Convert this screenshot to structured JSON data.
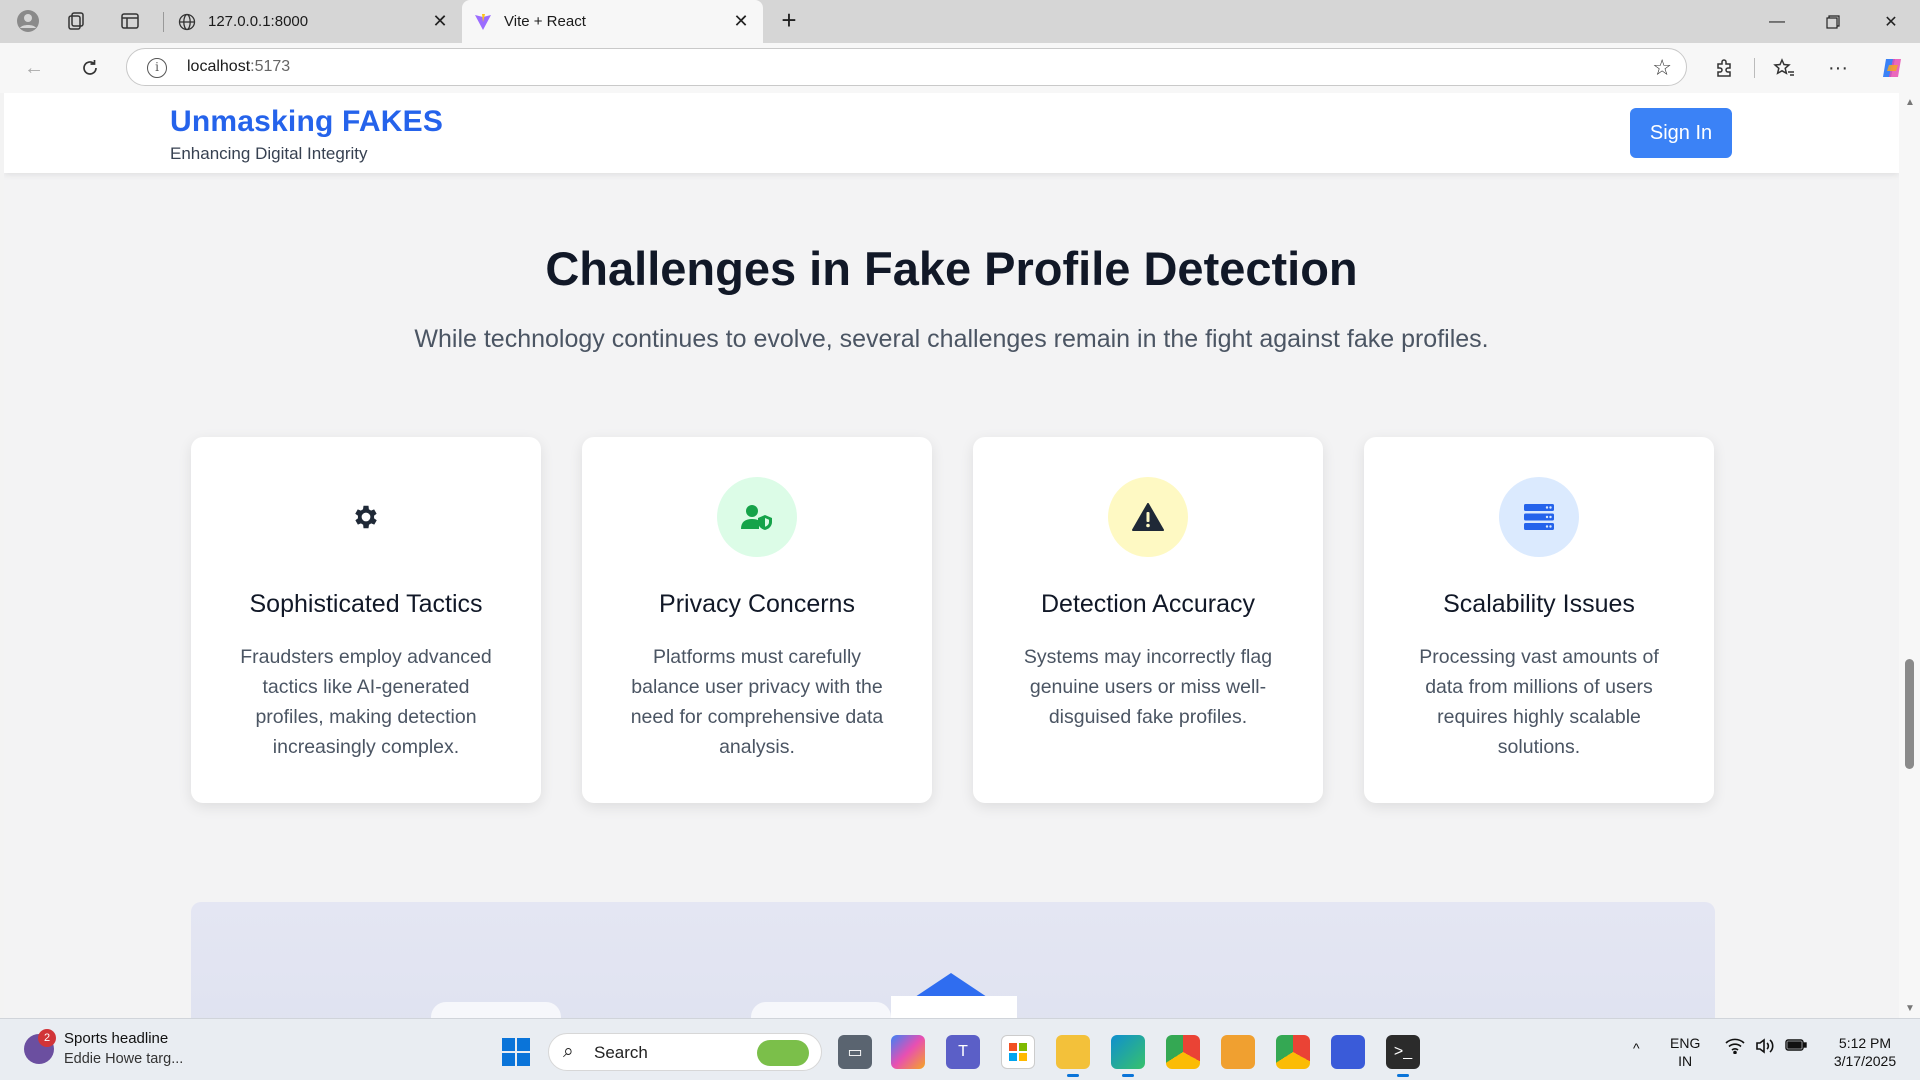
{
  "browser": {
    "tabs": [
      {
        "title": "127.0.0.1:8000",
        "active": false
      },
      {
        "title": "Vite + React",
        "active": true
      }
    ],
    "url_host": "localhost",
    "url_port": ":5173"
  },
  "site": {
    "brand_title": "Unmasking FAKES",
    "brand_subtitle": "Enhancing Digital Integrity",
    "signin_label": "Sign In"
  },
  "section": {
    "title": "Challenges in Fake Profile Detection",
    "subtitle": "While technology continues to evolve, several challenges remain in the fight against fake profiles."
  },
  "cards": [
    {
      "title": "Sophisticated Tactics",
      "description": "Fraudsters employ advanced tactics like AI-generated profiles, making detection increasingly complex.",
      "icon": "gear-icon",
      "circle_color": "#ffffff",
      "icon_color": "#1f2937"
    },
    {
      "title": "Privacy Concerns",
      "description": "Platforms must carefully balance user privacy with the need for comprehensive data analysis.",
      "icon": "user-shield-icon",
      "circle_color": "#dcfce7",
      "icon_color": "#16a34a"
    },
    {
      "title": "Detection Accuracy",
      "description": "Systems may incorrectly flag genuine users or miss well-disguised fake profiles.",
      "icon": "warning-icon",
      "circle_color": "#fef9c3",
      "icon_color": "#1f2937"
    },
    {
      "title": "Scalability Issues",
      "description": "Processing vast amounts of data from millions of users requires highly scalable solutions.",
      "icon": "server-icon",
      "circle_color": "#dbeafe",
      "icon_color": "#2563eb"
    }
  ],
  "taskbar": {
    "news_badge": "2",
    "news_title": "Sports headline",
    "news_sub": "Eddie Howe targ...",
    "search_label": "Search",
    "lang_top": "ENG",
    "lang_bottom": "IN",
    "time": "5:12 PM",
    "date": "3/17/2025"
  },
  "colors": {
    "brand": "#2563eb",
    "signin": "#3b82f6"
  }
}
